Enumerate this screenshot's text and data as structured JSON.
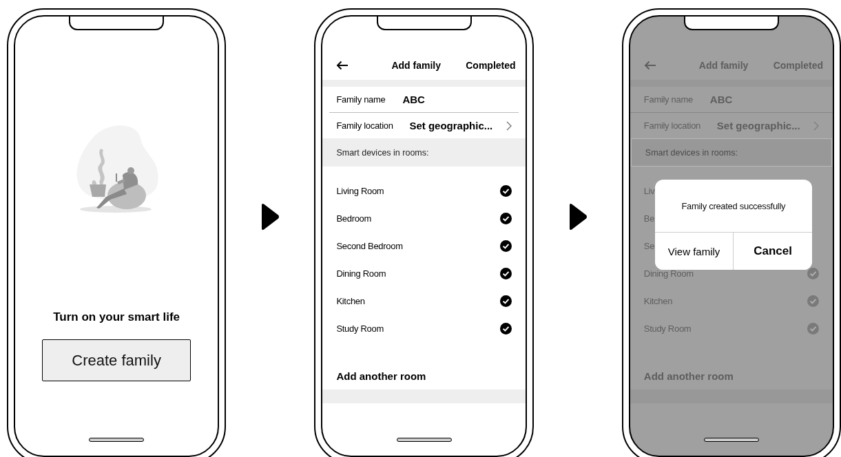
{
  "screens": [
    {
      "kind": "welcome",
      "title": "Turn on your smart life",
      "button": "Create family"
    },
    {
      "kind": "form",
      "dimmed": false,
      "header": {
        "title": "Add family",
        "action": "Completed"
      },
      "fields": [
        {
          "label": "Family name",
          "value": "ABC",
          "chevron": false
        },
        {
          "label": "Family location",
          "value": "Set geographic...",
          "chevron": true
        }
      ],
      "section": "Smart devices in rooms:",
      "rooms": [
        {
          "name": "Living Room",
          "checked": true
        },
        {
          "name": "Bedroom",
          "checked": true
        },
        {
          "name": "Second Bedroom",
          "checked": true
        },
        {
          "name": "Dining Room",
          "checked": true
        },
        {
          "name": "Kitchen",
          "checked": true
        },
        {
          "name": "Study Room",
          "checked": true
        }
      ],
      "add_room": "Add another room"
    },
    {
      "kind": "form",
      "dimmed": true,
      "header": {
        "title": "Add family",
        "action": "Completed"
      },
      "fields": [
        {
          "label": "Family name",
          "value": "ABC",
          "chevron": false
        },
        {
          "label": "Family location",
          "value": "Set geographic...",
          "chevron": true
        }
      ],
      "section": "Smart devices in rooms:",
      "rooms": [
        {
          "name": "Liv"
        },
        {
          "name": "Be"
        },
        {
          "name": "Se"
        },
        {
          "name": "Dining Room",
          "checked": true
        },
        {
          "name": "Kitchen",
          "checked": true
        },
        {
          "name": "Study Room",
          "checked": true
        }
      ],
      "add_room": "Add another room",
      "dialog": {
        "message": "Family created successfully",
        "buttons": [
          {
            "label": "View family",
            "kind": "normal"
          },
          {
            "label": "Cancel",
            "kind": "bold"
          }
        ]
      }
    }
  ]
}
